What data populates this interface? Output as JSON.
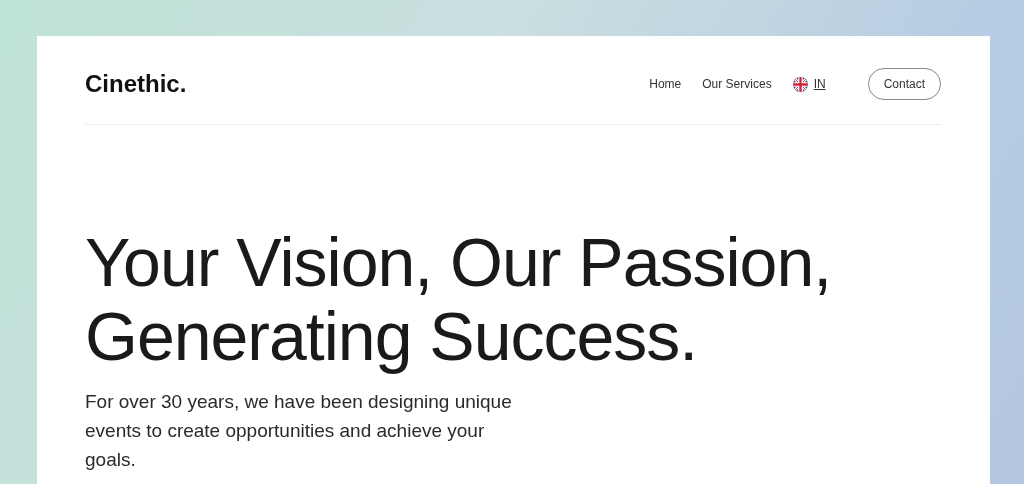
{
  "brand": {
    "logo": "Cinethic."
  },
  "nav": {
    "links": [
      {
        "label": "Home"
      },
      {
        "label": "Our Services"
      }
    ],
    "language": {
      "label": "IN"
    },
    "contact_button": {
      "label": "Contact"
    }
  },
  "hero": {
    "heading_lines": [
      "Your Vision, Our Passion,",
      "Generating Success."
    ],
    "text": "For over 30 years, we have been designing unique events to create opportunities and achieve your goals."
  }
}
